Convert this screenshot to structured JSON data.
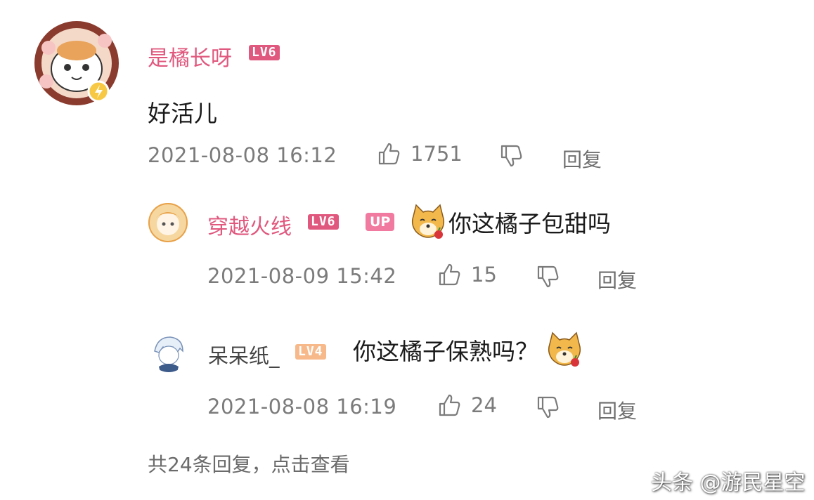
{
  "comment": {
    "username": "是橘长呀",
    "level": "LV6",
    "text": "好活儿",
    "timestamp": "2021-08-08 16:12",
    "likes": "1751",
    "reply_label": "回复"
  },
  "replies": [
    {
      "username": "穿越火线",
      "level": "LV6",
      "badge": "UP",
      "text": "你这橘子包甜吗",
      "timestamp": "2021-08-09 15:42",
      "likes": "15",
      "reply_label": "回复"
    },
    {
      "username": "呆呆纸_",
      "level": "LV4",
      "text": "你这橘子保熟吗？",
      "timestamp": "2021-08-08 16:19",
      "likes": "24",
      "reply_label": "回复"
    }
  ],
  "view_more": "共24条回复，点击查看",
  "watermark": "头条 @游民星空",
  "colors": {
    "username": "#e0587e",
    "level_badge": "#e0587e",
    "level4_badge": "#f7b98a",
    "up_badge": "#f07aa0",
    "meta": "#7b7b7b"
  }
}
